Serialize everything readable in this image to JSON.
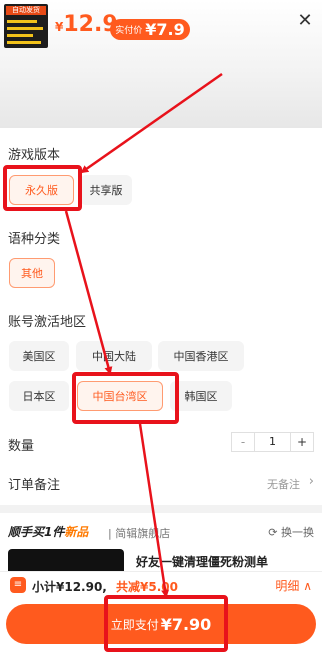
{
  "product": {
    "thumb_tag": "自动发货",
    "currency": "¥",
    "original_price": "12.9",
    "pay_badge_label": "实付价",
    "pay_badge_value": "¥7.9"
  },
  "sections": {
    "edition": {
      "title": "游戏版本",
      "options": [
        "永久版",
        "共享版"
      ],
      "selected": "永久版"
    },
    "language": {
      "title": "语种分类",
      "options": [
        "其他"
      ],
      "selected": "其他"
    },
    "region": {
      "title": "账号激活地区",
      "options": [
        "美国区",
        "中国大陆",
        "中国香港区",
        "日本区",
        "中国台湾区",
        "韩国区"
      ],
      "selected": "中国台湾区"
    }
  },
  "quantity": {
    "label": "数量",
    "minus": "-",
    "value": "1",
    "plus": "+"
  },
  "remark": {
    "label": "订单备注",
    "value": "无备注"
  },
  "promo": {
    "title_prefix": "顺手买1件",
    "title_highlight": "新品",
    "shop": "| 简辑旗舰店",
    "swap": "换一换",
    "item_text": "好友一键清理僵死粉测单"
  },
  "summary": {
    "subtotal": "小计¥12.90,",
    "discount": "共减¥5.00",
    "detail": "明细 ∧"
  },
  "pay_button": {
    "label": "立即支付",
    "value": "¥7.90"
  },
  "colors": {
    "accent": "#ff5a1e",
    "annotation": "#e8121b"
  },
  "icons": {
    "close": "close-icon",
    "chevron_right": "chevron-right-icon",
    "refresh": "refresh-icon",
    "cart": "cart-icon"
  }
}
